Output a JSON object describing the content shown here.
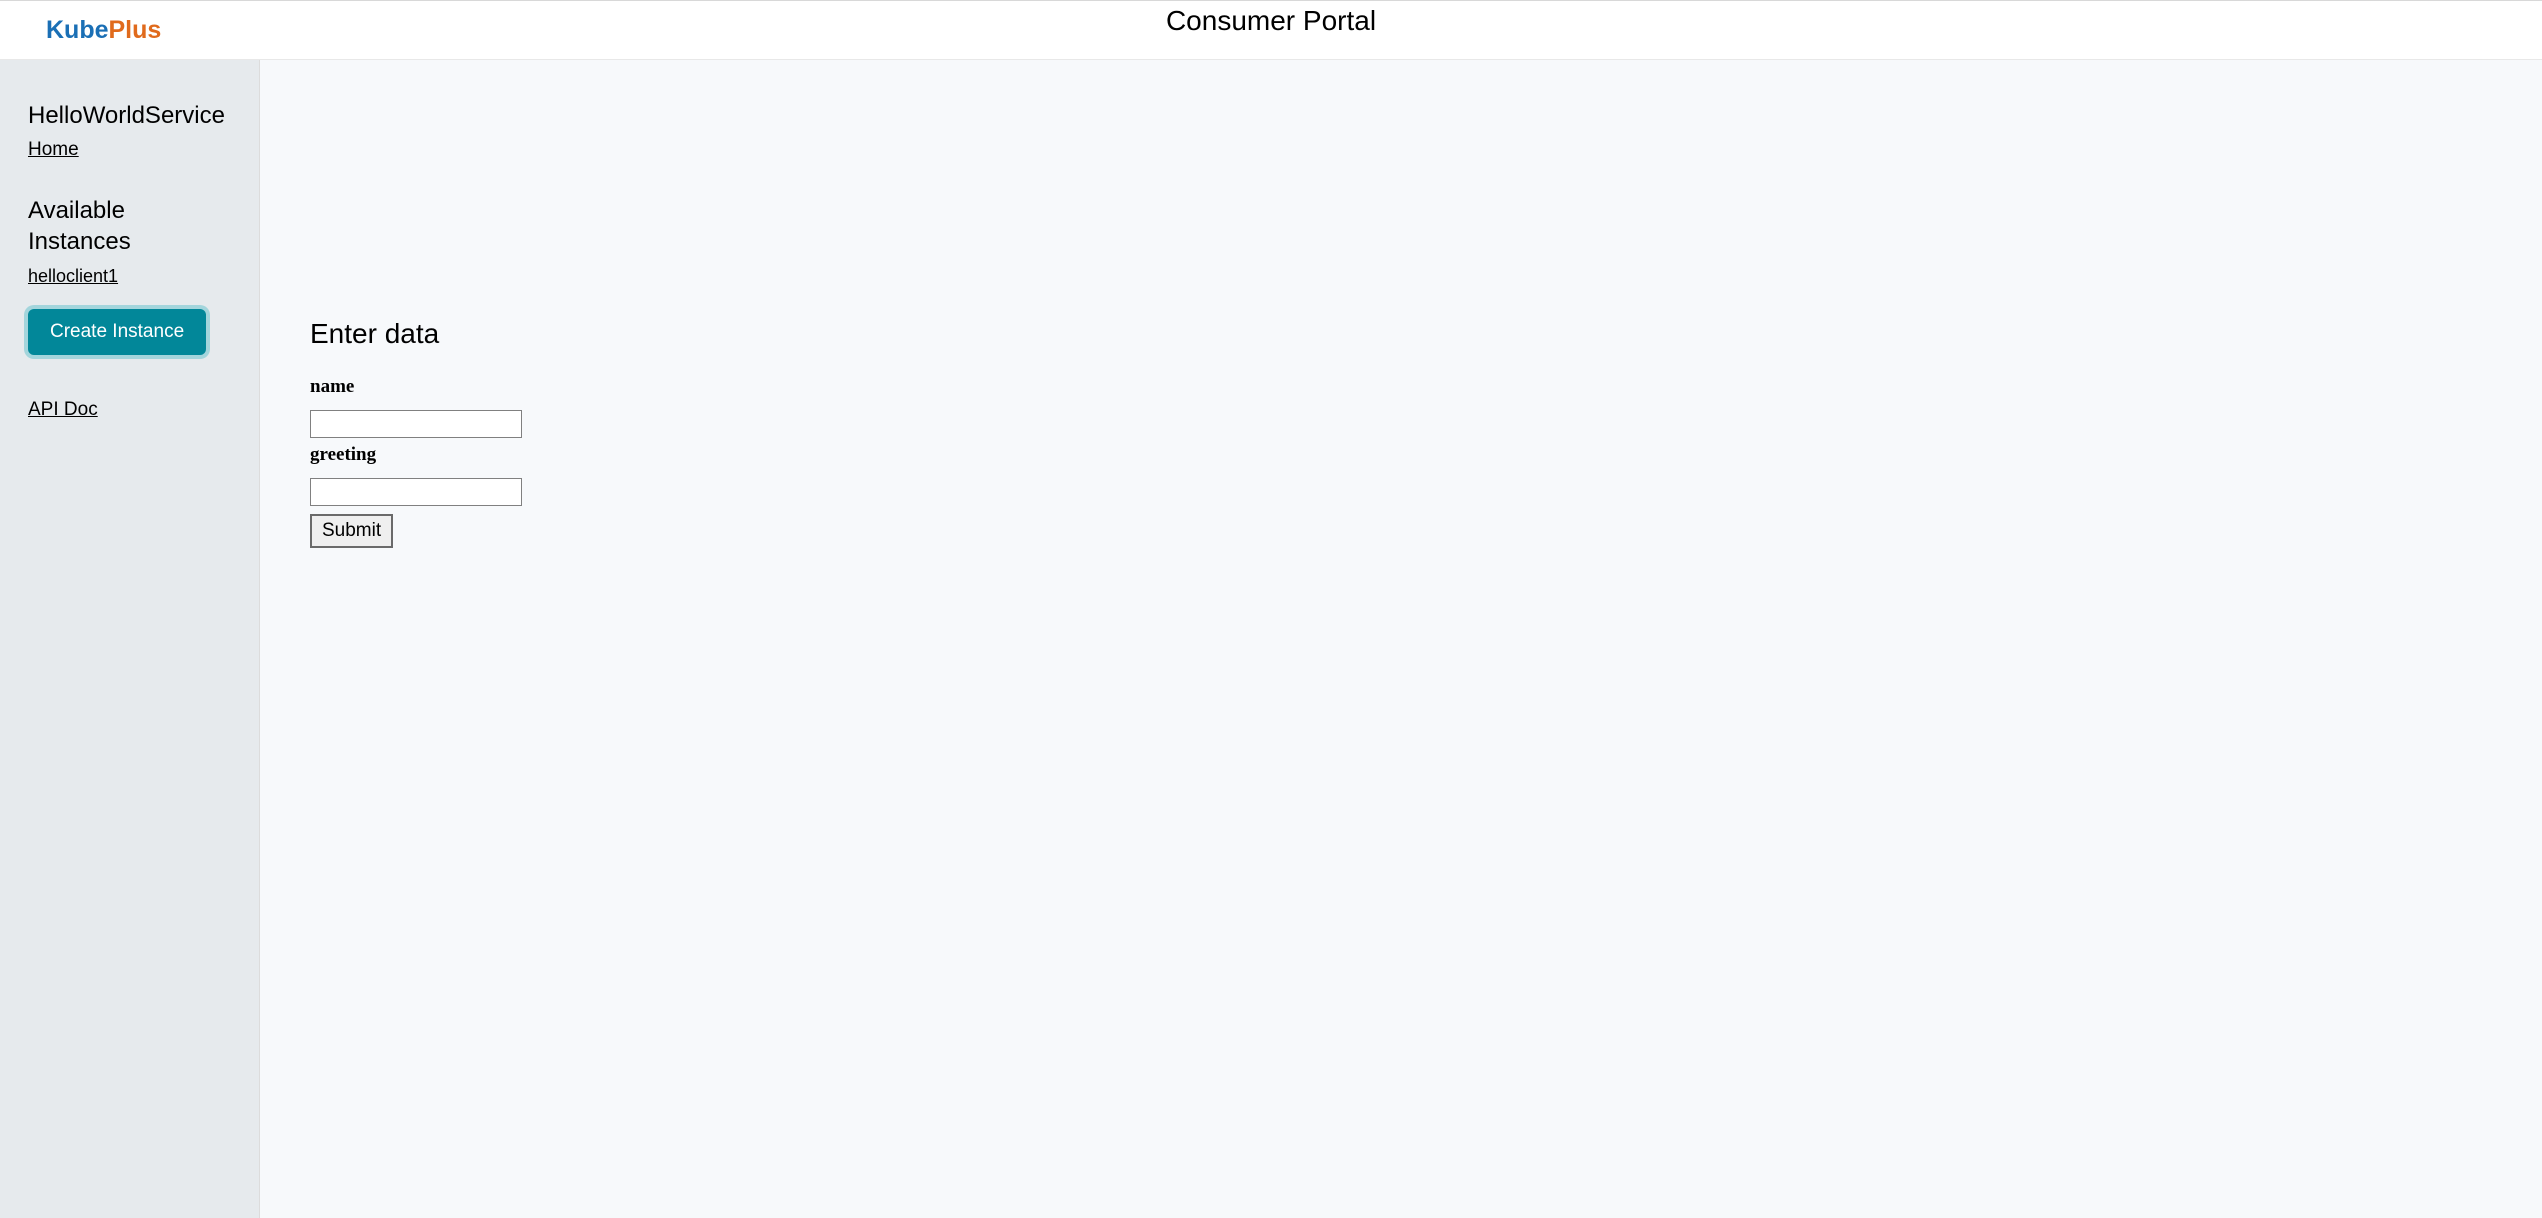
{
  "header": {
    "logo_part1": "Kube",
    "logo_part2": "Plus",
    "title": "Consumer Portal"
  },
  "sidebar": {
    "service_name": "HelloWorldService",
    "home_link": "Home",
    "instances_heading": "Available Instances",
    "instances": [
      {
        "label": "helloclient1"
      }
    ],
    "create_button": "Create Instance",
    "api_doc_link": "API Doc"
  },
  "main": {
    "form_title": "Enter data",
    "fields": {
      "name_label": "name",
      "name_value": "",
      "greeting_label": "greeting",
      "greeting_value": ""
    },
    "submit_label": "Submit"
  }
}
